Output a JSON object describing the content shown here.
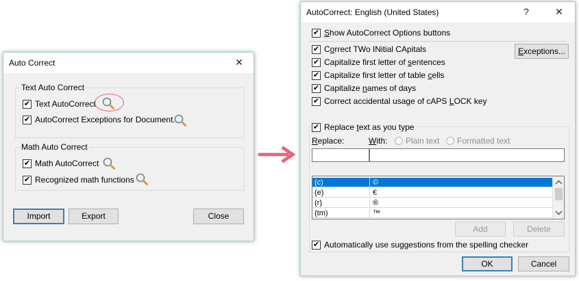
{
  "left_dialog": {
    "title": "Auto Correct",
    "close_glyph": "✕",
    "text_group": {
      "label": "Text Auto Correct",
      "items": [
        {
          "label": "Text AutoCorrect",
          "checked": true
        },
        {
          "label": "AutoCorrect Exceptions for Document.",
          "checked": true
        }
      ]
    },
    "math_group": {
      "label": "Math Auto Correct",
      "items": [
        {
          "label": "Math AutoCorrect",
          "checked": true
        },
        {
          "label": "Recognized math functions",
          "checked": true
        }
      ]
    },
    "buttons": {
      "import": "Import",
      "export": "Export",
      "close": "Close"
    },
    "highlight_color": "#e0606a"
  },
  "arrow": {
    "color": "#e8647a",
    "icon": "right-arrow-icon"
  },
  "right_dialog": {
    "title": "AutoCorrect: English (United States)",
    "help_glyph": "?",
    "close_glyph": "✕",
    "options": [
      {
        "pre": "",
        "u": "S",
        "post": "how AutoCorrect Options buttons",
        "checked": true
      },
      {
        "pre": "C",
        "u": "o",
        "post": "rrect TWo INitial CApitals",
        "checked": true
      },
      {
        "pre": "Capitalize first letter of ",
        "u": "s",
        "post": "entences",
        "checked": true
      },
      {
        "pre": "Capitalize first letter of table ",
        "u": "c",
        "post": "ells",
        "checked": true
      },
      {
        "pre": "Capitalize ",
        "u": "n",
        "post": "ames of days",
        "checked": true
      },
      {
        "pre": "Correct accidental usage of cAPS ",
        "u": "L",
        "post": "OCK key",
        "checked": true
      }
    ],
    "exceptions_button": {
      "pre": "",
      "u": "E",
      "post": "xceptions..."
    },
    "replace_as_you_type": {
      "pre": "Replace ",
      "u": "t",
      "post": "ext as you type",
      "checked": true
    },
    "replace_label": {
      "pre": "",
      "u": "R",
      "post": "eplace:"
    },
    "with_label": {
      "pre": "",
      "u": "W",
      "post": "ith:"
    },
    "plain_text": "Plain text",
    "formatted_text": "Formatted text",
    "replace_value": "",
    "with_value": "",
    "entries": [
      {
        "from": "(c)",
        "to": "©",
        "selected": true
      },
      {
        "from": "(e)",
        "to": "€",
        "selected": false
      },
      {
        "from": "(r)",
        "to": "®",
        "selected": false
      },
      {
        "from": "(tm)",
        "to": "™",
        "selected": false
      }
    ],
    "add_button": "Add",
    "delete_button": "Delete",
    "auto_suggest": {
      "label": "Automatically use suggestions from the spelling checker",
      "checked": true
    },
    "ok_button": "OK",
    "cancel_button": "Cancel"
  }
}
